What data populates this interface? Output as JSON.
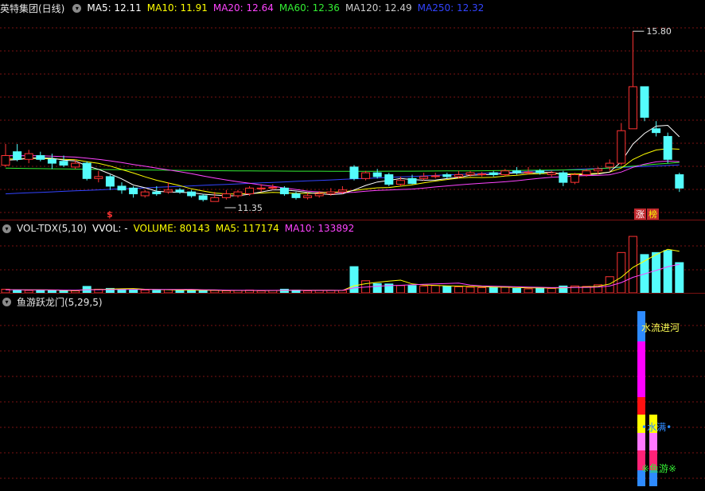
{
  "price_panel": {
    "title": "英特集团(日线)",
    "ma_labels": [
      {
        "text": "MA5: 12.11",
        "color": "#ffffff"
      },
      {
        "text": "MA10: 11.91",
        "color": "#ffff00"
      },
      {
        "text": "MA20: 12.64",
        "color": "#ff44ff"
      },
      {
        "text": "MA60: 12.36",
        "color": "#33ee33"
      },
      {
        "text": "MA120: 12.49",
        "color": "#cccccc"
      },
      {
        "text": "MA250: 12.32",
        "color": "#3344ff"
      }
    ],
    "high_label": "15.80",
    "low_label": "11.35",
    "marker_s": "$",
    "badge_zhang": "涨",
    "badge_bang": "榜"
  },
  "vol_panel": {
    "title": "VOL-TDX(5,10)",
    "vvol": "VVOL: -",
    "volume": "VOLUME: 80143",
    "ma5": "MA5: 117174",
    "ma10": "MA10: 133892"
  },
  "ind_panel": {
    "title": "鱼游跃龙门(5,29,5)",
    "label_water": "水流进河",
    "label_fill": "•水满•",
    "label_fish": "※鱼游※"
  },
  "colors": {
    "up": "#ff3333",
    "down": "#54fcfc",
    "grid": "#7a1212",
    "ma5": "#ffffff",
    "ma10": "#ffff00",
    "ma20": "#ff44ff",
    "ma60": "#33ee33",
    "ma250": "#3344ff"
  },
  "chart_data": {
    "type": "candlestick",
    "y_range": [
      11.0,
      16.2
    ],
    "ohlc": [
      [
        12.3,
        12.55,
        12.85,
        12.25
      ],
      [
        12.65,
        12.45,
        12.85,
        12.4
      ],
      [
        12.45,
        12.6,
        12.7,
        12.35
      ],
      [
        12.55,
        12.45,
        12.65,
        12.4
      ],
      [
        12.45,
        12.35,
        12.6,
        12.2
      ],
      [
        12.4,
        12.3,
        12.55,
        12.25
      ],
      [
        12.25,
        12.35,
        12.45,
        12.2
      ],
      [
        12.35,
        11.95,
        12.4,
        11.9
      ],
      [
        11.95,
        12.0,
        12.15,
        11.85
      ],
      [
        12.0,
        11.75,
        12.05,
        11.65
      ],
      [
        11.75,
        11.65,
        11.85,
        11.55
      ],
      [
        11.7,
        11.55,
        11.75,
        11.45
      ],
      [
        11.5,
        11.6,
        11.65,
        11.45
      ],
      [
        11.6,
        11.55,
        11.75,
        11.5
      ],
      [
        11.6,
        11.65,
        11.85,
        11.55
      ],
      [
        11.65,
        11.6,
        11.7,
        11.55
      ],
      [
        11.6,
        11.5,
        11.65,
        11.45
      ],
      [
        11.5,
        11.4,
        11.55,
        11.35
      ],
      [
        11.35,
        11.45,
        11.6,
        11.35
      ],
      [
        11.45,
        11.55,
        11.65,
        11.4
      ],
      [
        11.5,
        11.6,
        11.65,
        11.45
      ],
      [
        11.55,
        11.7,
        11.75,
        11.5
      ],
      [
        11.7,
        11.7,
        11.8,
        11.6
      ],
      [
        11.7,
        11.72,
        11.8,
        11.65
      ],
      [
        11.7,
        11.55,
        11.75,
        11.5
      ],
      [
        11.55,
        11.45,
        11.6,
        11.4
      ],
      [
        11.45,
        11.5,
        11.58,
        11.4
      ],
      [
        11.5,
        11.55,
        11.62,
        11.45
      ],
      [
        11.55,
        11.6,
        11.7,
        11.5
      ],
      [
        11.6,
        11.65,
        11.75,
        11.55
      ],
      [
        12.25,
        11.95,
        12.3,
        11.9
      ],
      [
        11.95,
        12.1,
        12.15,
        11.9
      ],
      [
        12.1,
        12.0,
        12.2,
        11.95
      ],
      [
        12.05,
        11.8,
        12.1,
        11.75
      ],
      [
        11.8,
        11.9,
        12.0,
        11.75
      ],
      [
        11.95,
        11.82,
        12.05,
        11.8
      ],
      [
        11.95,
        12.0,
        12.1,
        11.9
      ],
      [
        12.0,
        12.02,
        12.1,
        11.95
      ],
      [
        12.05,
        12.0,
        12.1,
        11.95
      ],
      [
        12.0,
        12.05,
        12.15,
        11.95
      ],
      [
        12.05,
        12.1,
        12.15,
        12.0
      ],
      [
        12.05,
        12.07,
        12.12,
        12.0
      ],
      [
        12.1,
        12.05,
        12.15,
        12.0
      ],
      [
        12.05,
        12.15,
        12.2,
        12.0
      ],
      [
        12.15,
        12.1,
        12.25,
        12.05
      ],
      [
        12.1,
        12.12,
        12.25,
        12.05
      ],
      [
        12.15,
        12.1,
        12.2,
        12.05
      ],
      [
        12.05,
        12.1,
        12.15,
        12.0
      ],
      [
        12.1,
        11.85,
        12.15,
        11.75
      ],
      [
        11.85,
        12.05,
        12.1,
        11.8
      ],
      [
        12.05,
        12.15,
        12.2,
        12.0
      ],
      [
        12.15,
        12.2,
        12.25,
        12.05
      ],
      [
        12.25,
        12.35,
        12.45,
        12.15
      ],
      [
        12.35,
        13.2,
        13.4,
        12.3
      ],
      [
        13.25,
        14.35,
        15.8,
        13.25
      ],
      [
        14.35,
        13.55,
        14.35,
        13.45
      ],
      [
        13.25,
        13.15,
        13.45,
        13.05
      ],
      [
        13.05,
        12.45,
        13.15,
        12.35
      ],
      [
        12.05,
        11.7,
        12.1,
        11.6
      ]
    ],
    "volume": [
      0.018,
      0.014,
      0.012,
      0.014,
      0.012,
      0.01,
      0.01,
      0.032,
      0.018,
      0.022,
      0.018,
      0.016,
      0.014,
      0.012,
      0.016,
      0.012,
      0.014,
      0.012,
      0.012,
      0.01,
      0.012,
      0.014,
      0.01,
      0.012,
      0.018,
      0.014,
      0.01,
      0.012,
      0.012,
      0.012,
      0.13,
      0.06,
      0.046,
      0.044,
      0.036,
      0.036,
      0.034,
      0.036,
      0.032,
      0.03,
      0.028,
      0.026,
      0.028,
      0.028,
      0.022,
      0.02,
      0.026,
      0.022,
      0.034,
      0.034,
      0.032,
      0.04,
      0.08,
      0.2,
      0.28,
      0.19,
      0.2,
      0.21,
      0.15
    ],
    "indicator_bars": [
      {
        "x": 806,
        "segments": [
          [
            390,
            428,
            "#2e8bff"
          ],
          [
            428,
            498,
            "#ff00ff"
          ],
          [
            498,
            520,
            "#ff1111"
          ],
          [
            520,
            543,
            "#ffff00"
          ],
          [
            543,
            565,
            "#ff77ff"
          ],
          [
            565,
            590,
            "#ff2277"
          ],
          [
            590,
            610,
            "#2e8bff"
          ]
        ]
      },
      {
        "x": 821,
        "segments": [
          [
            520,
            543,
            "#ffff00"
          ],
          [
            543,
            565,
            "#ff77ff"
          ],
          [
            565,
            590,
            "#ff2277"
          ],
          [
            590,
            610,
            "#2e8bff"
          ]
        ]
      }
    ]
  }
}
